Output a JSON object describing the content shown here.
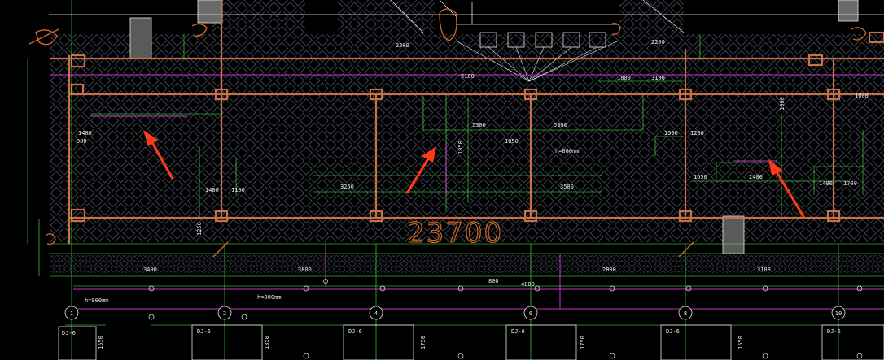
{
  "drawing": {
    "total_dimension": "23700",
    "axis_labels": [
      "1",
      "2",
      "4",
      "6",
      "8",
      "10"
    ],
    "footing_labels": [
      "DJ-6",
      "DJ-6",
      "DJ-6",
      "DJ-6",
      "DJ-6",
      "DJ-6"
    ],
    "bottom_dims": {
      "d1": "3400",
      "d2": "3800",
      "d3": "4800",
      "d4": "2800",
      "d5": "3100",
      "d6": "800"
    },
    "room_dims": {
      "left_1": "1400",
      "left_2": "900",
      "left_3": "1400",
      "left_4": "1100",
      "mid_1": "5300",
      "mid_2": "5300",
      "mid_3": "3250",
      "mid_4": "3500",
      "mid_5": "1850",
      "top_1": "5100",
      "top_2": "1800",
      "top_3": "3100",
      "top_4": "2200",
      "top_5": "2200",
      "right_1": "2400",
      "right_2": "1650",
      "right_3": "1500",
      "right_4": "1200",
      "right_5": "1700",
      "right_6": "1400",
      "right_7": "1000",
      "vert_1": "1250",
      "vert_2": "1550",
      "vert_3": "1350",
      "vert_4": "1750",
      "vert_5": "1550",
      "note_h": "h=800mm"
    },
    "colors": {
      "background": "#000000",
      "hatch": "#8fa0c0",
      "grid_axis": "#44ff44",
      "dimension": "#7cff5a",
      "magenta": "#ff44ff",
      "wall": "#c8704a",
      "annotation": "#ff3a1a",
      "white": "#e8e8e8"
    }
  }
}
